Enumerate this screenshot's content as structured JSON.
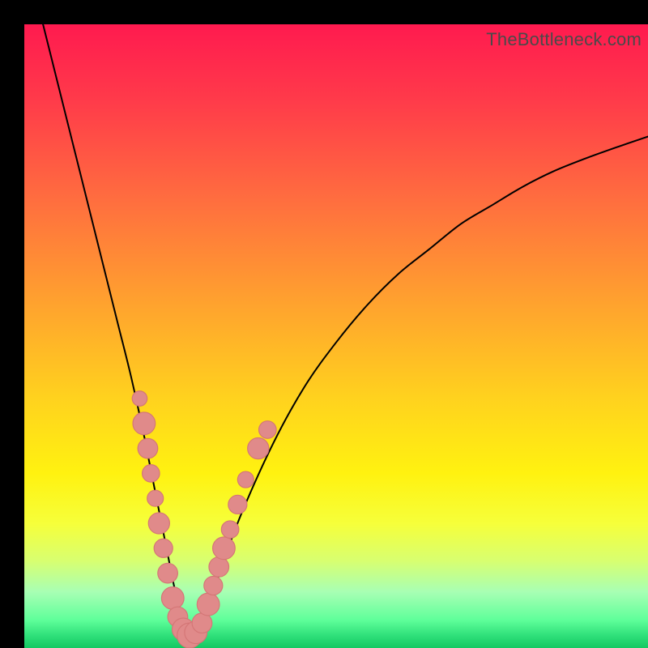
{
  "watermark": "TheBottleneck.com",
  "colors": {
    "frame": "#000000",
    "gradient_stops": [
      {
        "offset": 0.0,
        "color": "#ff1a4f"
      },
      {
        "offset": 0.12,
        "color": "#ff3a4a"
      },
      {
        "offset": 0.28,
        "color": "#ff6d3f"
      },
      {
        "offset": 0.45,
        "color": "#ffa32e"
      },
      {
        "offset": 0.6,
        "color": "#ffd21e"
      },
      {
        "offset": 0.72,
        "color": "#fff210"
      },
      {
        "offset": 0.8,
        "color": "#f6ff3a"
      },
      {
        "offset": 0.86,
        "color": "#d8ff70"
      },
      {
        "offset": 0.91,
        "color": "#a8ffb4"
      },
      {
        "offset": 0.955,
        "color": "#5fff9a"
      },
      {
        "offset": 0.98,
        "color": "#2fe07a"
      },
      {
        "offset": 1.0,
        "color": "#14c862"
      }
    ],
    "curve": "#000000",
    "marker_fill": "#e08a8a",
    "marker_stroke": "#d47676"
  },
  "chart_data": {
    "type": "line",
    "title": "",
    "xlabel": "",
    "ylabel": "",
    "xlim": [
      0,
      100
    ],
    "ylim": [
      0,
      100
    ],
    "series": [
      {
        "name": "bottleneck-curve",
        "x": [
          3,
          5,
          7,
          9,
          11,
          13,
          15,
          17,
          19,
          20,
          21,
          22,
          23,
          24,
          25,
          26,
          27,
          28,
          30,
          32,
          35,
          40,
          45,
          50,
          55,
          60,
          65,
          70,
          75,
          80,
          85,
          90,
          95,
          100
        ],
        "y": [
          100,
          92,
          84,
          76,
          68,
          60,
          52,
          44,
          35,
          30,
          25,
          20,
          15,
          10,
          6,
          3,
          2,
          3,
          8,
          14,
          22,
          33,
          42,
          49,
          55,
          60,
          64,
          68,
          71,
          74,
          76.5,
          78.5,
          80.3,
          82
        ]
      }
    ],
    "markers": {
      "name": "highlighted-points",
      "points": [
        {
          "x": 18.5,
          "y": 40,
          "r": 1.2
        },
        {
          "x": 19.2,
          "y": 36,
          "r": 1.8
        },
        {
          "x": 19.8,
          "y": 32,
          "r": 1.6
        },
        {
          "x": 20.3,
          "y": 28,
          "r": 1.4
        },
        {
          "x": 21.0,
          "y": 24,
          "r": 1.3
        },
        {
          "x": 21.6,
          "y": 20,
          "r": 1.7
        },
        {
          "x": 22.3,
          "y": 16,
          "r": 1.5
        },
        {
          "x": 23.0,
          "y": 12,
          "r": 1.6
        },
        {
          "x": 23.8,
          "y": 8,
          "r": 1.8
        },
        {
          "x": 24.6,
          "y": 5,
          "r": 1.6
        },
        {
          "x": 25.5,
          "y": 3,
          "r": 1.8
        },
        {
          "x": 26.5,
          "y": 2,
          "r": 2.0
        },
        {
          "x": 27.5,
          "y": 2.5,
          "r": 1.8
        },
        {
          "x": 28.5,
          "y": 4,
          "r": 1.6
        },
        {
          "x": 29.5,
          "y": 7,
          "r": 1.8
        },
        {
          "x": 30.3,
          "y": 10,
          "r": 1.5
        },
        {
          "x": 31.2,
          "y": 13,
          "r": 1.6
        },
        {
          "x": 32.0,
          "y": 16,
          "r": 1.8
        },
        {
          "x": 33.0,
          "y": 19,
          "r": 1.4
        },
        {
          "x": 34.2,
          "y": 23,
          "r": 1.5
        },
        {
          "x": 35.5,
          "y": 27,
          "r": 1.3
        },
        {
          "x": 37.5,
          "y": 32,
          "r": 1.7
        },
        {
          "x": 39.0,
          "y": 35,
          "r": 1.4
        }
      ]
    }
  }
}
